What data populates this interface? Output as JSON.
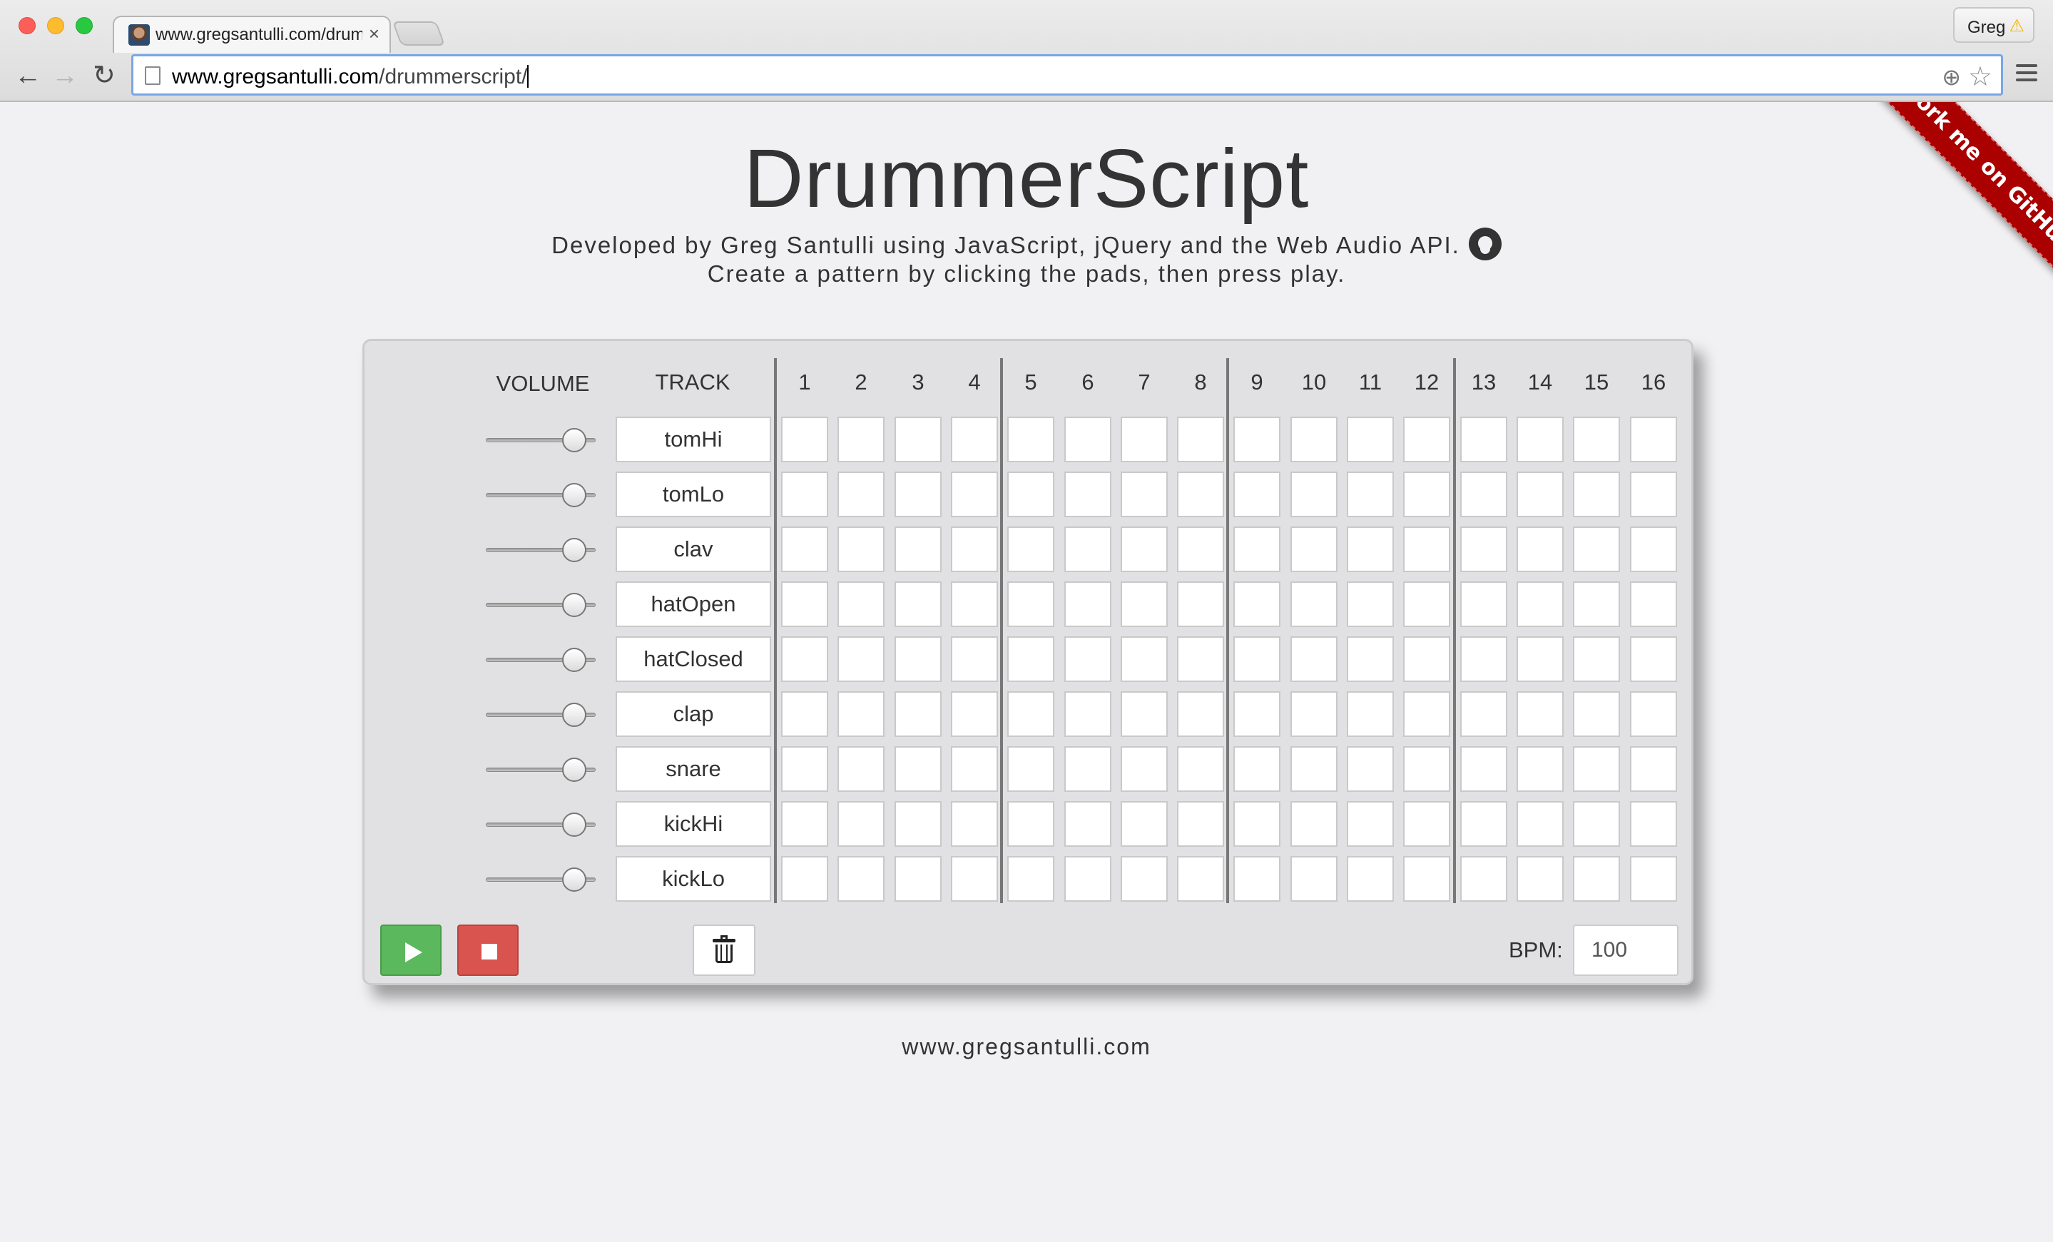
{
  "browser": {
    "tab_title": "www.gregsantulli.com/drummerscript/",
    "tab_close": "×",
    "profile_name": "Greg",
    "profile_warning": "⚠",
    "url_host": "www.gregsantulli.com",
    "url_path": "/drummerscript/",
    "back_glyph": "←",
    "forward_glyph": "→",
    "reload_glyph": "↻",
    "zoom_glyph": "⊕",
    "star_glyph": "☆"
  },
  "page": {
    "title": "DrummerScript",
    "subtitle_line1": "Developed by Greg Santulli using JavaScript, jQuery and the Web Audio API.",
    "subtitle_line2": "Create a pattern by clicking the pads, then press play.",
    "ribbon": "Fork me on GitHub",
    "footer": "www.gregsantulli.com"
  },
  "sequencer": {
    "volume_header": "VOLUME",
    "track_header": "TRACK",
    "steps": [
      "1",
      "2",
      "3",
      "4",
      "5",
      "6",
      "7",
      "8",
      "9",
      "10",
      "11",
      "12",
      "13",
      "14",
      "15",
      "16"
    ],
    "tracks": [
      {
        "name": "tomHi",
        "volume": 0.8
      },
      {
        "name": "tomLo",
        "volume": 0.8
      },
      {
        "name": "clav",
        "volume": 0.8
      },
      {
        "name": "hatOpen",
        "volume": 0.8
      },
      {
        "name": "hatClosed",
        "volume": 0.8
      },
      {
        "name": "clap",
        "volume": 0.8
      },
      {
        "name": "snare",
        "volume": 0.8
      },
      {
        "name": "kickHi",
        "volume": 0.8
      },
      {
        "name": "kickLo",
        "volume": 0.8
      }
    ],
    "bpm_label": "BPM:",
    "bpm_value": "100"
  },
  "colors": {
    "play": "#5cb85c",
    "stop": "#d9534f",
    "ribbon": "#aa0000"
  }
}
